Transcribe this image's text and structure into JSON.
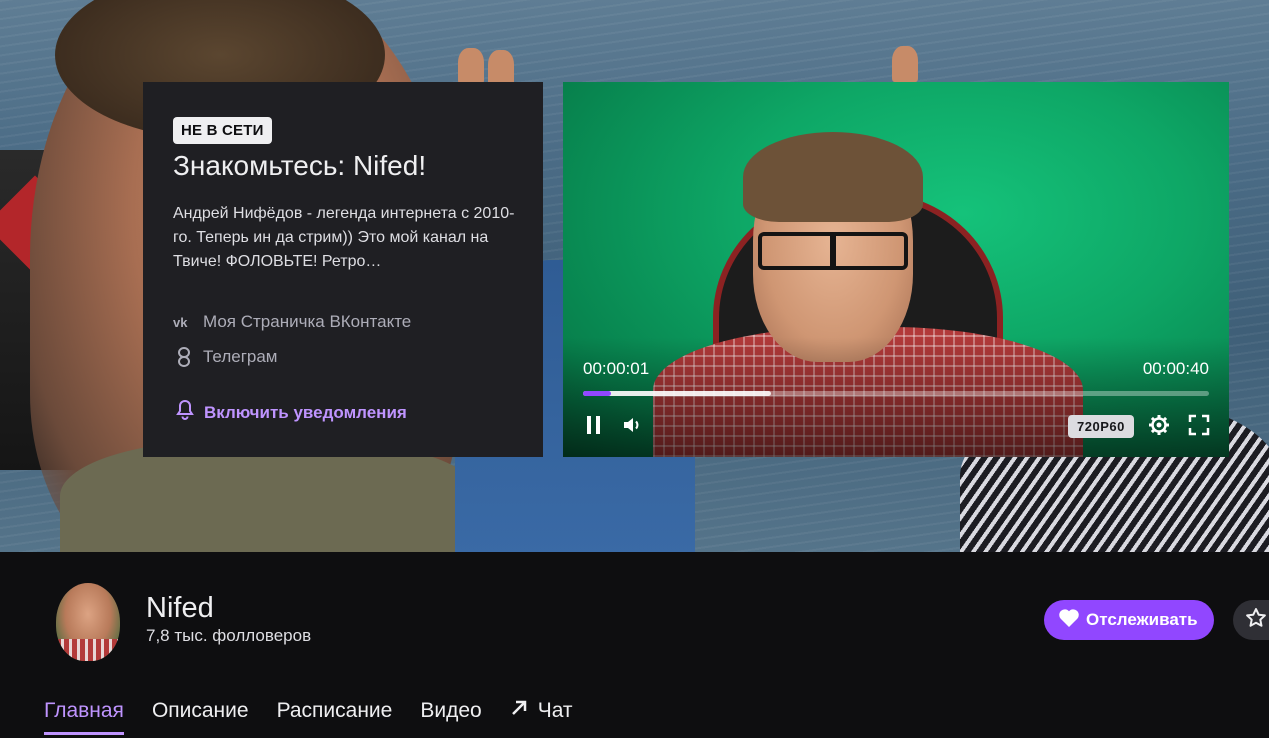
{
  "about": {
    "badge": "НЕ В СЕТИ",
    "title": "Знакомьтесь: Nifed!",
    "description": "Андрей Нифёдов - легенда интернета с 2010-го. Теперь ин да стрим)) Это мой канал на Твиче! ФОЛОВЬТЕ! Ретро…",
    "links": [
      {
        "label": "Моя Страничка ВКонтакте",
        "icon": "vk-icon"
      },
      {
        "label": "Телеграм",
        "icon": "link-icon"
      }
    ],
    "notify_label": "Включить уведомления"
  },
  "player": {
    "current_time": "00:00:01",
    "duration": "00:00:40",
    "played_fraction": 0.045,
    "buffered_fraction": 0.3,
    "quality": "720P60"
  },
  "channel": {
    "name": "Nifed",
    "followers": "7,8 тыс. фолловеров",
    "follow_label": "Отслеживать"
  },
  "tabs": [
    {
      "label": "Главная",
      "active": true
    },
    {
      "label": "Описание",
      "active": false
    },
    {
      "label": "Расписание",
      "active": false
    },
    {
      "label": "Видео",
      "active": false
    },
    {
      "label": "Чат",
      "active": false
    }
  ],
  "colors": {
    "accent": "#9147ff",
    "accent_text": "#bf94ff",
    "background": "#0e0e10",
    "panel": "#1f1f23"
  }
}
